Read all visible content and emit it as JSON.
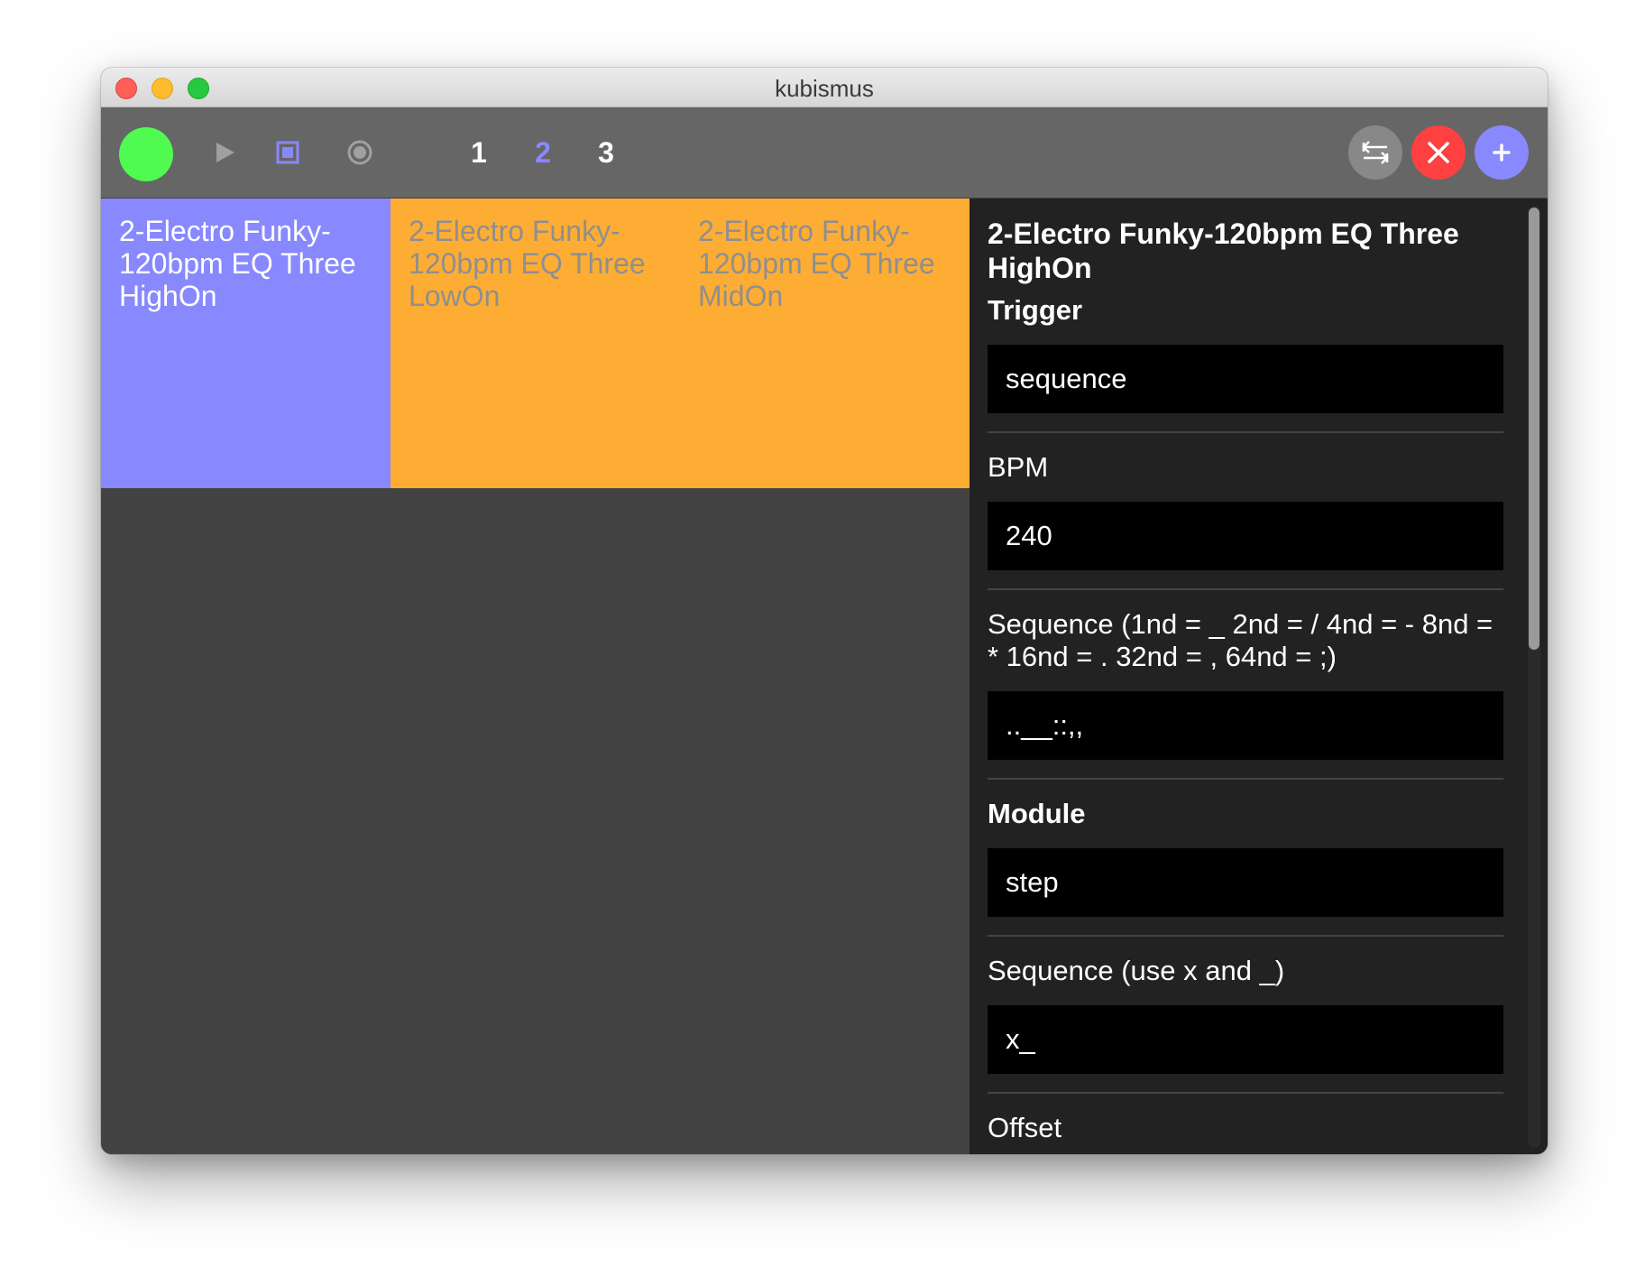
{
  "window": {
    "title": "kubismus"
  },
  "toolbar": {
    "status_color": "#50fa50",
    "play_icon": "play-icon",
    "stop_icon": "stop-icon",
    "record_icon": "record-icon",
    "scenes": [
      {
        "label": "1",
        "active": false
      },
      {
        "label": "2",
        "active": true
      },
      {
        "label": "3",
        "active": false
      }
    ],
    "active_color": "#8888ff",
    "actions": [
      {
        "icon": "swap-icon",
        "color": "#888888"
      },
      {
        "icon": "close-icon",
        "color": "#ff4040"
      },
      {
        "icon": "plus-icon",
        "color": "#8888ff"
      }
    ]
  },
  "clips": [
    {
      "label": "2-Electro Funky-120bpm EQ Three HighOn",
      "bg": "#8888ff",
      "text_color": "#ffffff",
      "selected": true
    },
    {
      "label": "2-Electro Funky-120bpm EQ Three LowOn",
      "bg": "#fead34",
      "text_color": "#8f8f8f",
      "selected": false
    },
    {
      "label": "2-Electro Funky-120bpm EQ Three MidOn",
      "bg": "#fead34",
      "text_color": "#8f8f8f",
      "selected": false
    }
  ],
  "panel": {
    "title": "2-Electro Funky-120bpm EQ Three HighOn",
    "fields": [
      {
        "label": "Trigger",
        "value": "sequence",
        "bold": true
      },
      {
        "label": "BPM",
        "value": "240",
        "bold": false
      },
      {
        "label": "Sequence (1nd = _ 2nd = / 4nd = - 8nd = * 16nd = . 32nd = , 64nd = ;)",
        "value": "..__::,,",
        "bold": false
      },
      {
        "label": "Module",
        "value": "step",
        "bold": true
      },
      {
        "label": "Sequence (use x and _)",
        "value": "x_",
        "bold": false
      },
      {
        "label": "Offset",
        "value": "",
        "bold": false
      }
    ]
  }
}
